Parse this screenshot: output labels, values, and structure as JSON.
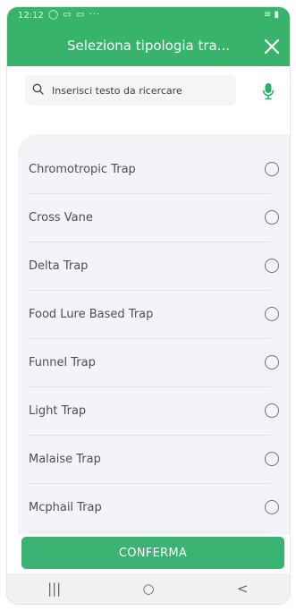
{
  "status": {
    "time": "12:12",
    "icons": "◯ ▭ ▭ ···",
    "right": "≡ ▮"
  },
  "header": {
    "title": "Seleziona tipologia tra...",
    "close_icon": "close-icon"
  },
  "search": {
    "placeholder": "Inserisci testo da ricercare",
    "value": "",
    "mic_icon": "microphone-icon"
  },
  "items": [
    {
      "label": "Chromotropic Trap"
    },
    {
      "label": "Cross Vane"
    },
    {
      "label": "Delta Trap"
    },
    {
      "label": "Food Lure Based Trap"
    },
    {
      "label": "Funnel Trap"
    },
    {
      "label": "Light Trap"
    },
    {
      "label": "Malaise Trap"
    },
    {
      "label": "Mcphail Trap"
    }
  ],
  "confirm_label": "CONFERMA",
  "nav": {
    "recent": "|||",
    "home": "○",
    "back": "<"
  },
  "colors": {
    "accent": "#38b36c",
    "button": "#39b272",
    "panel": "#f2f4f7"
  }
}
